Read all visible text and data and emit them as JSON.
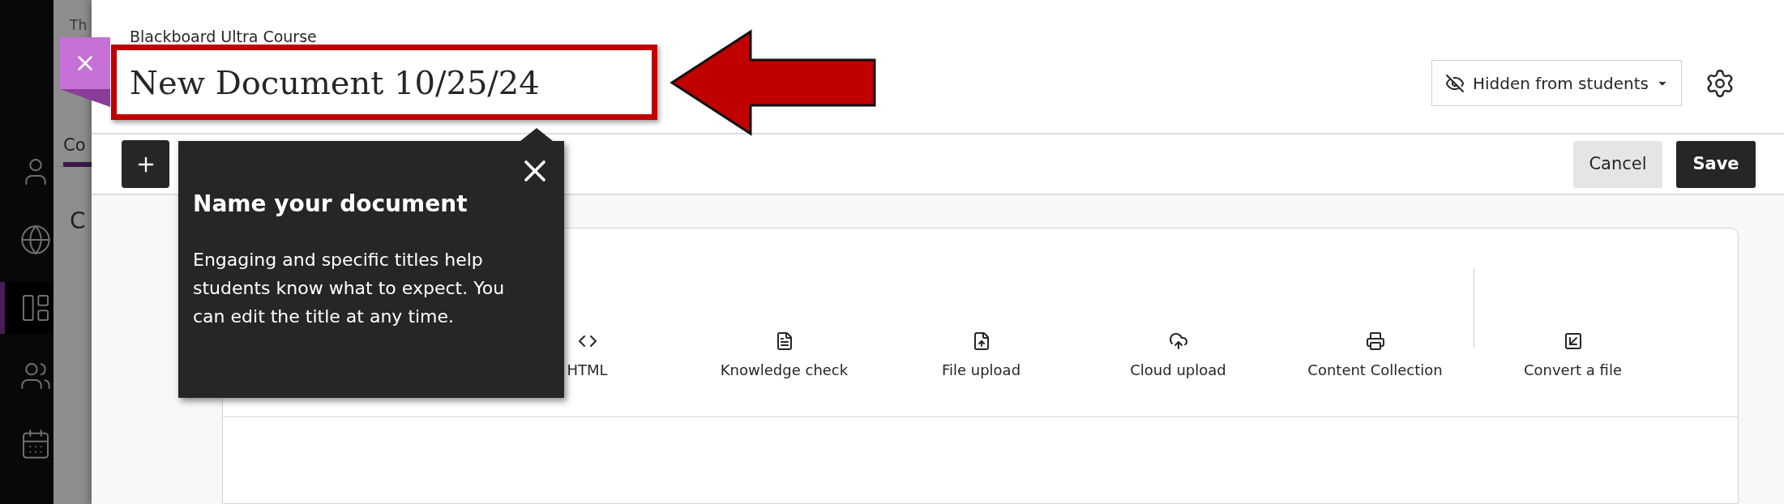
{
  "background": {
    "header_fragment": "Th",
    "tab_fragment": "Co",
    "heading_fragment": "C",
    "nav_items": [
      {
        "kind": "person",
        "selected": false
      },
      {
        "kind": "globe",
        "selected": false
      },
      {
        "kind": "content",
        "selected": true
      },
      {
        "kind": "people",
        "selected": false
      },
      {
        "kind": "calendar",
        "selected": false
      }
    ]
  },
  "course_name": "Blackboard Ultra Course",
  "title": {
    "value": "New Document 10/25/24"
  },
  "visibility": {
    "label": "Hidden from students"
  },
  "buttons": [
    {
      "label": "Cancel",
      "kind": "secondary"
    },
    {
      "label": "Save",
      "kind": "primary"
    }
  ],
  "tooltip": {
    "title": "Name your document",
    "body": "Engaging and specific titles help students know what to expect. You can edit the title at any time."
  },
  "toolbar": [
    {
      "kind": "html",
      "label": "HTML"
    },
    {
      "kind": "knowledge",
      "label": "Knowledge check"
    },
    {
      "kind": "file",
      "label": "File upload"
    },
    {
      "kind": "cloud",
      "label": "Cloud upload"
    },
    {
      "kind": "collection",
      "label": "Content Collection"
    },
    {
      "kind": "convert",
      "label": "Convert a file"
    }
  ]
}
